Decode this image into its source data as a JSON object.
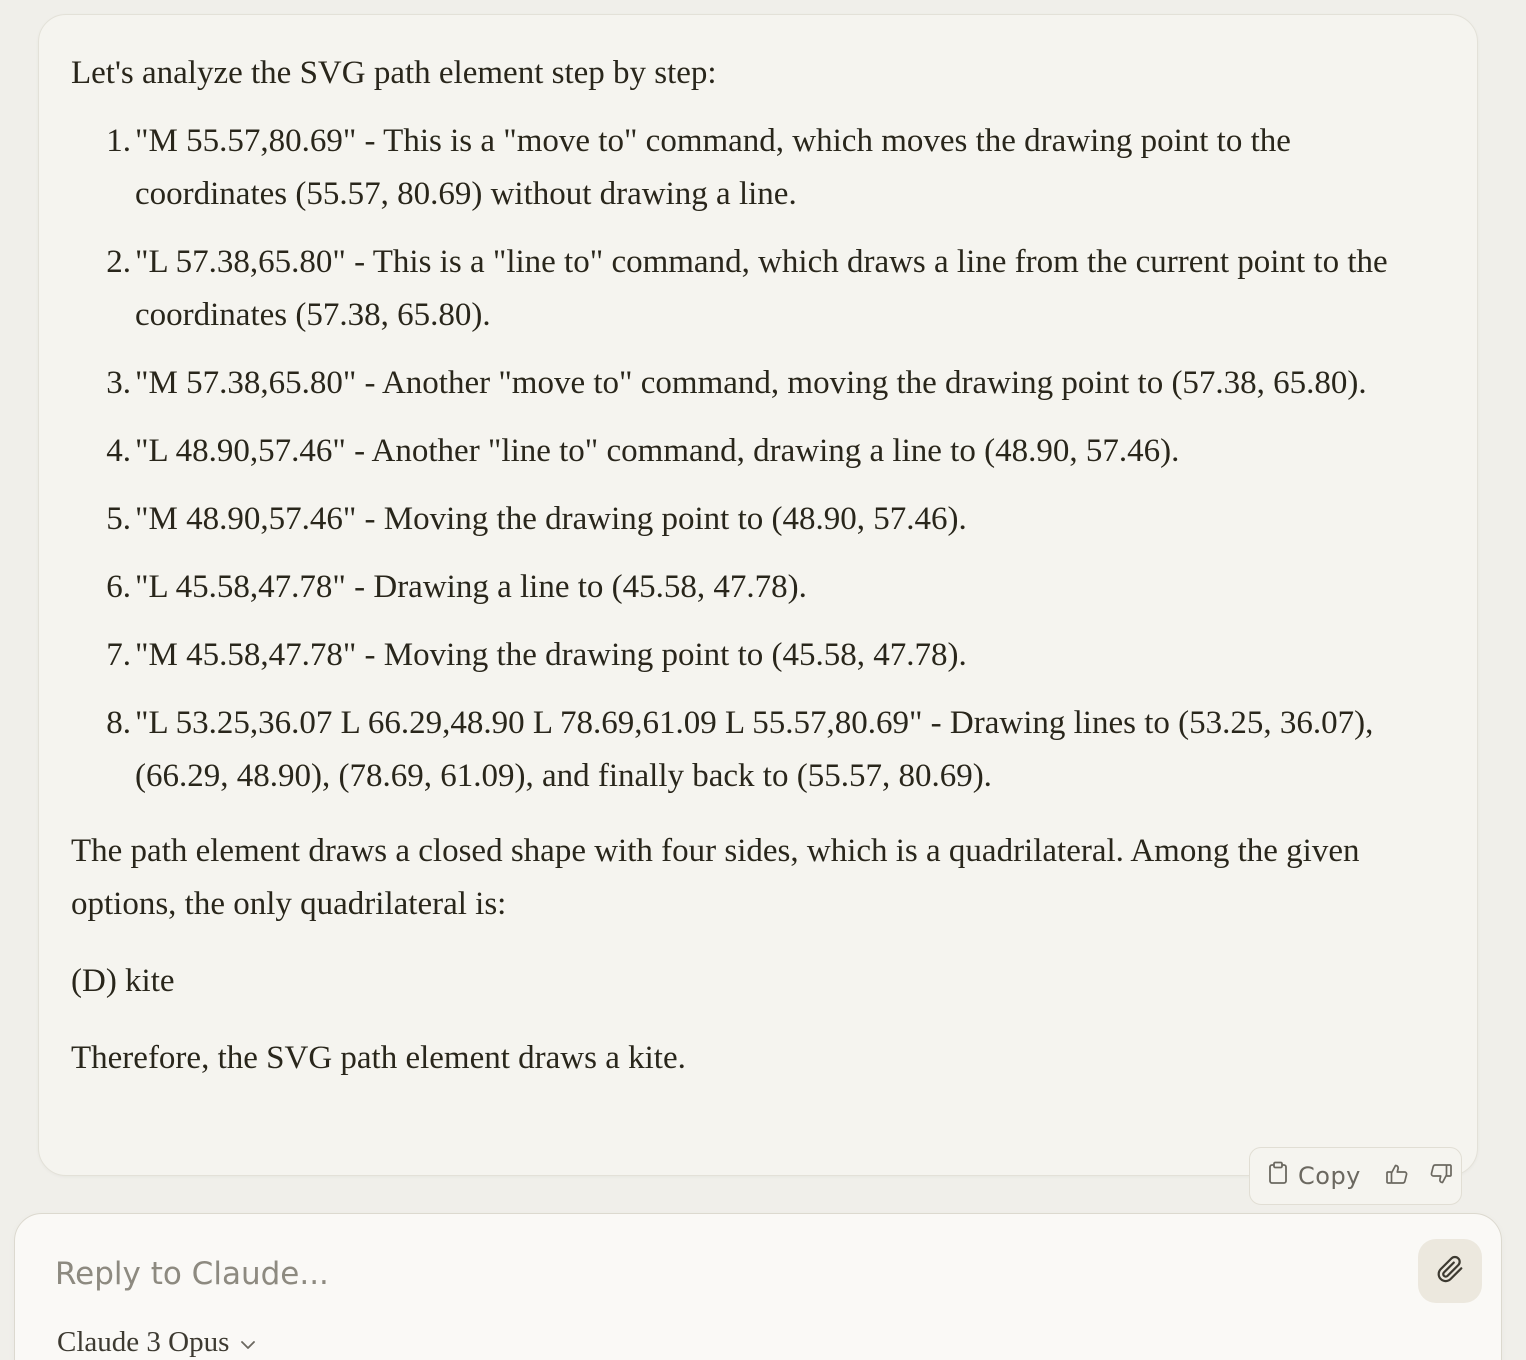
{
  "message": {
    "intro": "Let's analyze the SVG path element step by step:",
    "steps": [
      {
        "num": "1.",
        "text": "\"M 55.57,80.69\" - This is a \"move to\" command, which moves the drawing point to the coordinates (55.57, 80.69) without drawing a line."
      },
      {
        "num": "2.",
        "text": "\"L 57.38,65.80\" - This is a \"line to\" command, which draws a line from the current point to the coordinates (57.38, 65.80)."
      },
      {
        "num": "3.",
        "text": "\"M 57.38,65.80\" - Another \"move to\" command, moving the drawing point to (57.38, 65.80)."
      },
      {
        "num": "4.",
        "text": "\"L 48.90,57.46\" - Another \"line to\" command, drawing a line to (48.90, 57.46)."
      },
      {
        "num": "5.",
        "text": "\"M 48.90,57.46\" - Moving the drawing point to (48.90, 57.46)."
      },
      {
        "num": "6.",
        "text": "\"L 45.58,47.78\" - Drawing a line to (45.58, 47.78)."
      },
      {
        "num": "7.",
        "text": "\"M 45.58,47.78\" - Moving the drawing point to (45.58, 47.78)."
      },
      {
        "num": "8.",
        "text": "\"L 53.25,36.07 L 66.29,48.90 L 78.69,61.09 L 55.57,80.69\" - Drawing lines to (53.25, 36.07), (66.29, 48.90), (78.69, 61.09), and finally back to (55.57, 80.69)."
      }
    ],
    "conclusion": "The path element draws a closed shape with four sides, which is a quadrilateral. Among the given options, the only quadrilateral is:",
    "answer": "(D) kite",
    "final": "Therefore, the SVG path element draws a kite."
  },
  "actions": {
    "copy_label": "Copy",
    "icons": [
      "clipboard-icon",
      "thumbs-up-icon",
      "thumbs-down-icon"
    ]
  },
  "composer": {
    "placeholder": "Reply to Claude...",
    "model": "Claude 3 Opus",
    "icons": [
      "paperclip-icon",
      "chevron-down-icon"
    ]
  },
  "colors": {
    "background": "#f0efea",
    "card": "#f5f4ef",
    "text": "#29261b",
    "muted": "#6b6860"
  }
}
